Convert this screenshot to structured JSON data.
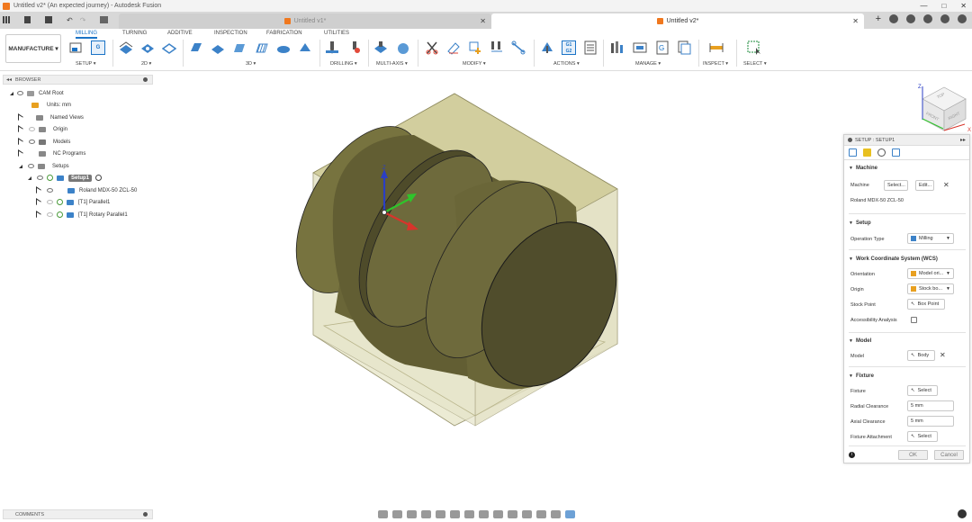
{
  "window": {
    "title": "Untitled v2* (An expected journey) - Autodesk Fusion",
    "controls": [
      "—",
      "□",
      "✕"
    ]
  },
  "tabs": [
    {
      "label": "Untitled v1*",
      "active": false
    },
    {
      "label": "Untitled v2*",
      "active": true
    }
  ],
  "ribbon": {
    "workspace": "MANUFACTURE ▾",
    "tabs": [
      "MILLING",
      "TURNING",
      "ADDITIVE",
      "INSPECTION",
      "FABRICATION",
      "UTILITIES"
    ],
    "active_tab": "MILLING",
    "groups": [
      "SETUP ▾",
      "2D ▾",
      "3D ▾",
      "DRILLING ▾",
      "MULTI-AXIS ▾",
      "MODIFY ▾",
      "ACTIONS ▾",
      "MANAGE ▾",
      "INSPECT ▾",
      "SELECT ▾"
    ],
    "gcode_label": "G1\nG2",
    "accent": "#1a73c6"
  },
  "browser": {
    "title": "BROWSER",
    "items": {
      "cam_root": "CAM Root",
      "units": "Units: mm",
      "named_views": "Named Views",
      "origin": "Origin",
      "models": "Models",
      "nc_programs": "NC Programs",
      "setups": "Setups",
      "setup1": "Setup1",
      "machine": "Roland MDX-50 ZCL-50",
      "op1": "[T1] Parallel1",
      "op2": "[T1] Rotary Parallel1"
    }
  },
  "comments": {
    "title": "COMMENTS"
  },
  "dialog": {
    "title": "SETUP : SETUP1",
    "sections": {
      "machine": "Machine",
      "setup": "Setup",
      "wcs": "Work Coordinate System (WCS)",
      "model": "Model",
      "fixture": "Fixture"
    },
    "fields": {
      "machine_label": "Machine",
      "machine_select": "Select...",
      "machine_edit": "Edit...",
      "machine_name": "Roland MDX-50 ZCL-50",
      "operation_type_label": "Operation Type",
      "operation_type_value": "Milling",
      "orientation_label": "Orientation",
      "orientation_value": "Model ori...",
      "origin_label": "Origin",
      "origin_value": "Stock bo...",
      "stock_point_label": "Stock Point",
      "stock_point_value": "Box Point",
      "accessibility_label": "Accessibility Analysis",
      "model_label": "Model",
      "model_value": "Body",
      "fixture_label": "Fixture",
      "fixture_value": "Select",
      "radial_label": "Radial Clearance",
      "radial_value": "5 mm",
      "axial_label": "Axial Clearance",
      "axial_value": "5 mm",
      "attachment_label": "Fixture Attachment",
      "attachment_value": "Select"
    },
    "ok": "OK",
    "cancel": "Cancel"
  },
  "viewcube": {
    "top": "TOP",
    "front": "FRONT",
    "right": "RIGHT",
    "axis_z": "Z",
    "axis_x": "X",
    "axis_y": "Y"
  },
  "viewport_axes": {
    "z": "Z"
  },
  "colors": {
    "stock_fill": "#d8d4b0",
    "cylinder": "#6e6a3c",
    "cylinder_dark": "#4e4b2a",
    "background": "#ffffff"
  }
}
